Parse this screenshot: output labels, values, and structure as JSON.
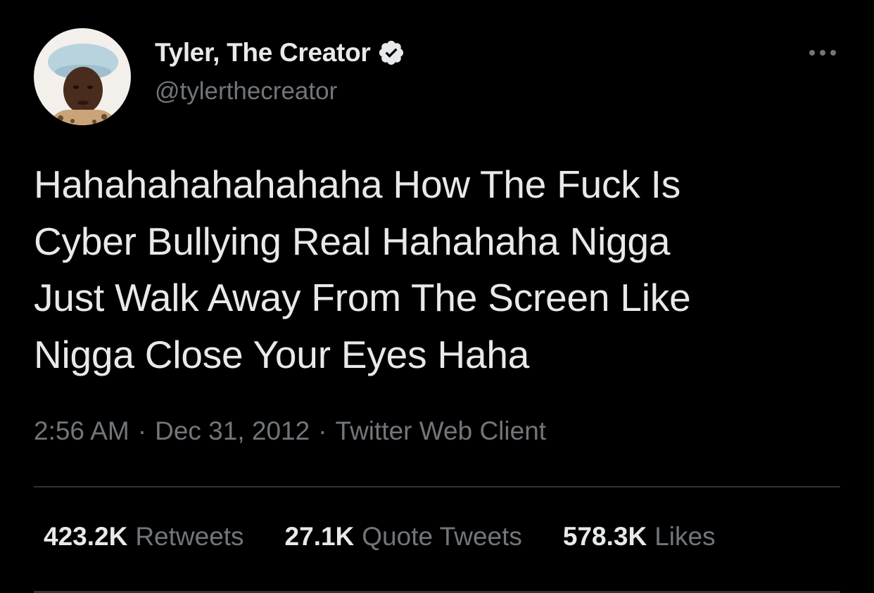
{
  "author": {
    "display_name": "Tyler, The Creator",
    "handle": "@tylerthecreator",
    "verified_icon": "verified-badge-icon",
    "avatar_icon": "profile-photo"
  },
  "more_icon": "more-horizontal-icon",
  "tweet": {
    "text": "Hahahahahahahaha How The Fuck Is\nCyber Bullying Real Hahahaha Nigga\nJust Walk Away From The Screen Like\nNigga Close Your Eyes Haha"
  },
  "meta": {
    "time": "2:56 AM",
    "separator": "·",
    "date": "Dec 31, 2012",
    "client": "Twitter Web Client"
  },
  "stats": [
    {
      "value": "423.2K",
      "label": "Retweets"
    },
    {
      "value": "27.1K",
      "label": "Quote Tweets"
    },
    {
      "value": "578.3K",
      "label": "Likes"
    }
  ],
  "colors": {
    "background": "#000000",
    "primary_text": "#e7e9ea",
    "secondary_text": "#71767b",
    "divider": "#2f3336"
  }
}
